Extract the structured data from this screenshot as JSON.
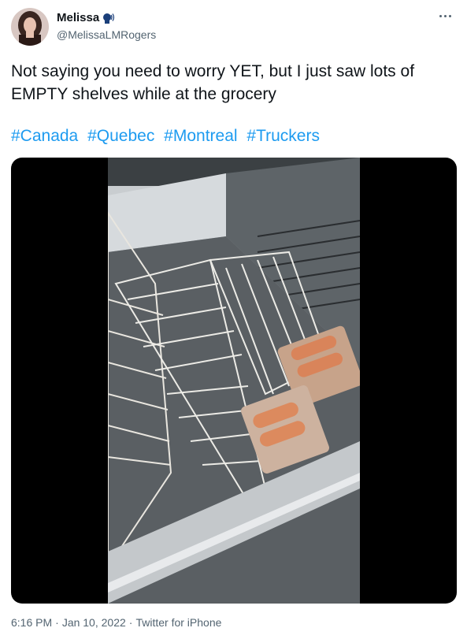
{
  "user": {
    "display_name": "Melissa",
    "display_name_icon": "speaking-head-icon",
    "handle": "@MelissaLMRogers"
  },
  "menu": {
    "more_icon": "more-horizontal-icon"
  },
  "tweet": {
    "text": "Not saying you need to worry YET, but I just saw lots of EMPTY shelves while at the grocery",
    "hashtags": [
      "#Canada",
      "#Quebec",
      "#Montreal",
      "#Truckers"
    ]
  },
  "media": {
    "type": "video-thumbnail"
  },
  "meta": {
    "time": "6:16 PM",
    "separator": "·",
    "date": "Jan 10, 2022",
    "source": "Twitter for iPhone"
  },
  "colors": {
    "link": "#1d9bf0",
    "secondary_text": "#536471",
    "primary_text": "#0f1419"
  }
}
